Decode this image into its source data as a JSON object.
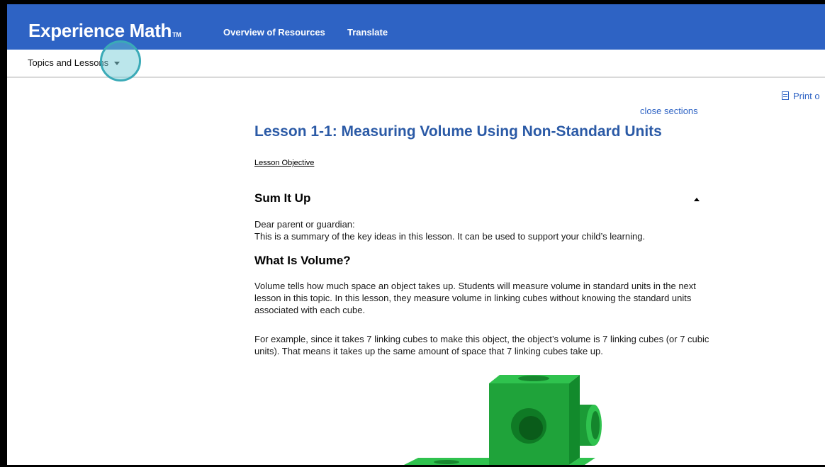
{
  "header": {
    "brand": "Experience Math",
    "brand_mark": "TM",
    "nav": [
      "Overview of Resources",
      "Translate"
    ]
  },
  "subnav": {
    "topics_label": "Topics and Lessons"
  },
  "toolbar": {
    "print_label": "Print o"
  },
  "lesson": {
    "close_sections": "close sections",
    "title": "Lesson 1-1: Measuring Volume Using Non-Standard Units",
    "objective_link": "Lesson Objective",
    "section_title": "Sum It Up",
    "greeting": "Dear parent or guardian:",
    "summary": "This is a summary of the key ideas in this lesson. It can be used to support your child’s learning.",
    "subheading": "What Is Volume?",
    "para1": "Volume tells how much space an object takes up. Students will measure volume in standard units in the next lesson in this topic. In this lesson, they measure volume in linking cubes without knowing the standard units associated with each cube.",
    "para2": "For example, since it takes 7 linking cubes to make this object, the object’s volume is 7 linking cubes (or 7 cubic units). That means it takes up the same amount of space that 7 linking cubes take up."
  },
  "colors": {
    "header_bg": "#2e63c4",
    "link": "#2e63c4",
    "title": "#2b5aa6",
    "cube_green": "#1fa33a",
    "focus_ring": "#3aaab7"
  }
}
